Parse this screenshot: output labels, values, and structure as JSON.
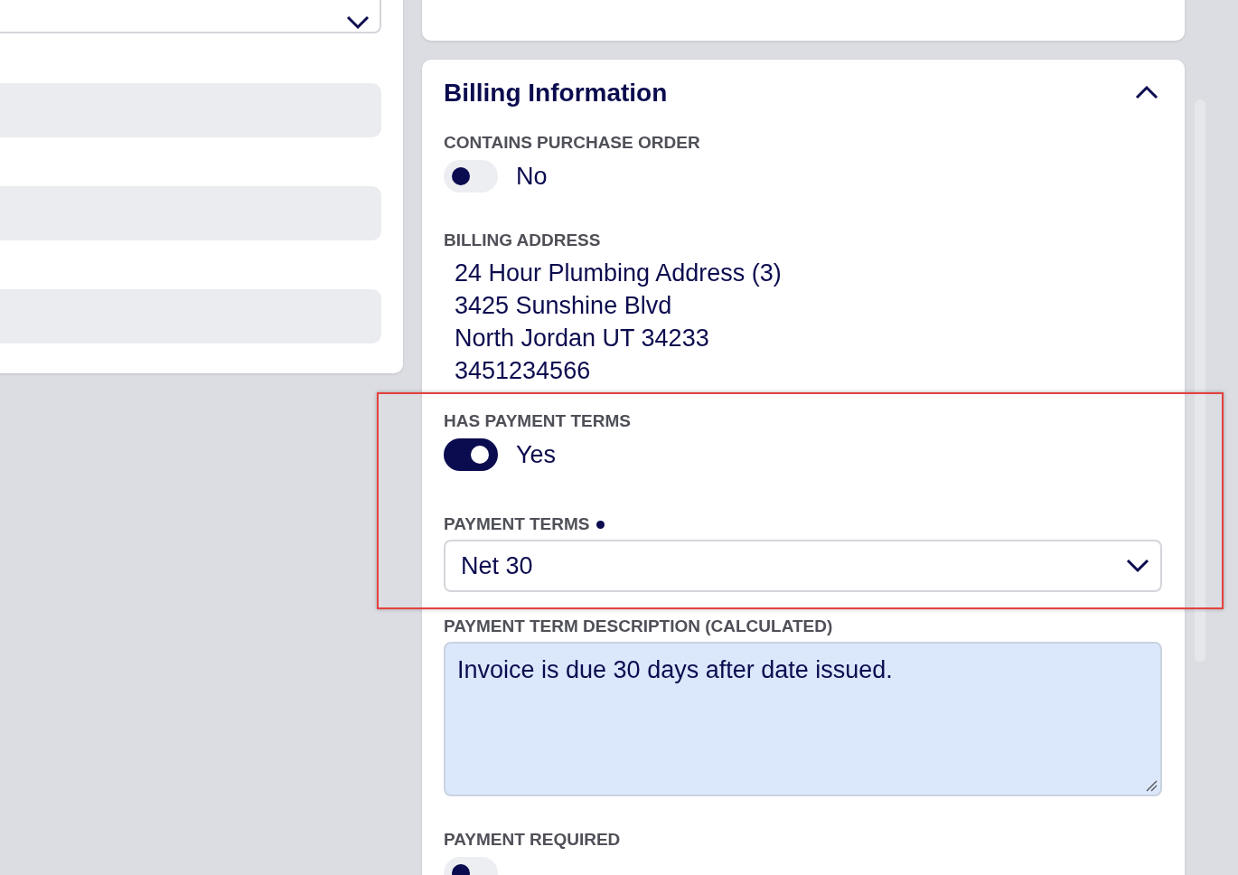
{
  "billing_card": {
    "title": "Billing Information",
    "expanded": true,
    "fields": [
      {
        "kind": "toggle",
        "label": "CONTAINS PURCHASE ORDER",
        "on": false,
        "value": "No",
        "highlighted": false
      },
      {
        "kind": "address",
        "label": "BILLING ADDRESS",
        "lines": [
          "24 Hour Plumbing Address (3)",
          "3425 Sunshine Blvd",
          "North Jordan UT 34233",
          "3451234566"
        ],
        "highlighted": false
      },
      {
        "kind": "toggle",
        "label": "HAS PAYMENT TERMS",
        "on": true,
        "value": "Yes",
        "highlighted": true
      },
      {
        "kind": "select",
        "label": "PAYMENT TERMS",
        "required": true,
        "value": "Net 30",
        "highlighted": true
      },
      {
        "kind": "textarea",
        "label": "PAYMENT TERM DESCRIPTION (CALCULATED)",
        "value": "Invoice is due 30 days after date issued.",
        "highlighted": false
      },
      {
        "kind": "toggle",
        "label": "PAYMENT REQUIRED",
        "on": false,
        "highlighted": false
      }
    ]
  }
}
